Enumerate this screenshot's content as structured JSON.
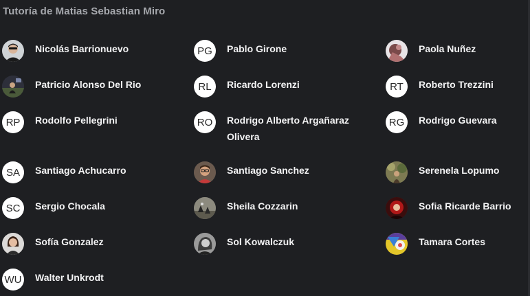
{
  "header": {
    "title": "Tutoría de Matias Sebastian Miro"
  },
  "members": [
    {
      "name": "Nicolás Barrionuevo",
      "initials": "",
      "avatar": "photo"
    },
    {
      "name": "Pablo Girone",
      "initials": "PG",
      "avatar": "initials"
    },
    {
      "name": "Paola Nuñez",
      "initials": "",
      "avatar": "photo"
    },
    {
      "name": "Patricio Alonso Del Rio",
      "initials": "",
      "avatar": "photo"
    },
    {
      "name": "Ricardo Lorenzi",
      "initials": "RL",
      "avatar": "initials"
    },
    {
      "name": "Roberto Trezzini",
      "initials": "RT",
      "avatar": "initials"
    },
    {
      "name": "Rodolfo Pellegrini",
      "initials": "RP",
      "avatar": "initials"
    },
    {
      "name": "Rodrigo Alberto Argañaraz Olivera",
      "initials": "RO",
      "avatar": "initials"
    },
    {
      "name": "Rodrigo Guevara",
      "initials": "RG",
      "avatar": "initials"
    },
    {
      "name": "Santiago Achucarro",
      "initials": "SA",
      "avatar": "initials"
    },
    {
      "name": "Santiago Sanchez",
      "initials": "",
      "avatar": "photo"
    },
    {
      "name": "Serenela Lopumo",
      "initials": "",
      "avatar": "photo"
    },
    {
      "name": "Sergio Chocala",
      "initials": "SC",
      "avatar": "initials"
    },
    {
      "name": "Sheila Cozzarin",
      "initials": "",
      "avatar": "photo"
    },
    {
      "name": "Sofia Ricarde Barrio",
      "initials": "",
      "avatar": "photo"
    },
    {
      "name": "Sofía Gonzalez",
      "initials": "",
      "avatar": "photo"
    },
    {
      "name": "Sol Kowalczuk",
      "initials": "",
      "avatar": "photo"
    },
    {
      "name": "Tamara Cortes",
      "initials": "",
      "avatar": "photo"
    },
    {
      "name": "Walter Unkrodt",
      "initials": "WU",
      "avatar": "initials"
    }
  ],
  "colors": {
    "background": "#1e1f22",
    "title": "#a6a8ad",
    "name": "#f3f3f4",
    "avatar_bg": "#ffffff"
  }
}
